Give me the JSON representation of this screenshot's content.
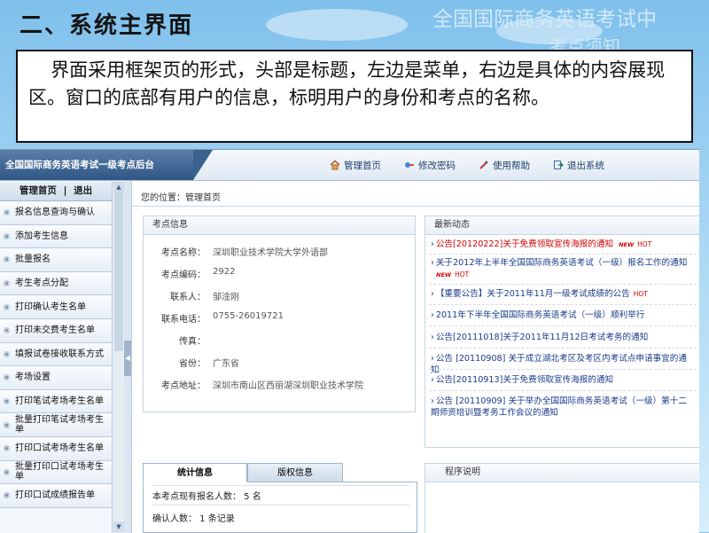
{
  "slide": {
    "title": "二、系统主界面",
    "watermark_line1": "全国国际商务英语考试中",
    "watermark_line2": "考点须知",
    "description": "界面采用框架页的形式，头部是标题，左边是菜单，右边是具体的内容展现区。窗口的底部有用户的信息，标明用户的身份和考点的名称。"
  },
  "app": {
    "brand": "全国国际商务英语考试一级考点后台",
    "nav": [
      {
        "label": "管理首页",
        "icon": "home-icon"
      },
      {
        "label": "修改密码",
        "icon": "key-icon"
      },
      {
        "label": "使用帮助",
        "icon": "help-icon"
      },
      {
        "label": "退出系统",
        "icon": "logout-icon"
      }
    ],
    "sidebar": {
      "home_link": "管理首页",
      "separator": "|",
      "logout_link": "退出",
      "items": [
        "报名信息查询与确认",
        "添加考生信息",
        "批量报名",
        "考生考点分配",
        "打印确认考生名单",
        "打印未交费考生名单",
        "填报试卷接收联系方式",
        "考场设置",
        "打印笔试考场考生名单",
        "批量打印笔试考场考生单",
        "打印口试考场考生名单",
        "批量打印口试考场考生单",
        "打印口试成绩报告单"
      ]
    },
    "breadcrumb": "您的位置：管理首页",
    "site_info": {
      "header": "考点信息",
      "rows": [
        {
          "label": "考点名称：",
          "value": "深圳职业技术学院大学外语部"
        },
        {
          "label": "考点编码：",
          "value": "2922"
        },
        {
          "label": "联系人：",
          "value": "邹淦刚"
        },
        {
          "label": "联系电话：",
          "value": "0755-26019721"
        },
        {
          "label": "传真：",
          "value": ""
        },
        {
          "label": "省份：",
          "value": "广东省"
        },
        {
          "label": "考点地址：",
          "value": "深圳市南山区西丽湖深圳职业技术学院"
        }
      ]
    },
    "news": {
      "header": "最新动态",
      "items": [
        {
          "text": "公告[20120222]关于免费领取宣传海报的通知",
          "new": "NEW",
          "hot": "HOT",
          "red": true
        },
        {
          "text": "关于2012年上半年全国国际商务英语考试（一级）报名工作的通知",
          "new": "NEW",
          "hot": "HOT",
          "red": false
        },
        {
          "text": "【重要公告】关于2011年11月一级考试成绩的公告",
          "new": "",
          "hot": "HOT",
          "red": false
        },
        {
          "text": "2011年下半年全国国际商务英语考试（一级）顺利举行",
          "new": "",
          "hot": "",
          "red": false
        },
        {
          "text": "公告[20111018]关于2011年11月12日考试考务的通知",
          "new": "",
          "hot": "",
          "red": false
        },
        {
          "text": "公告 [20110908] 关于成立湖北考区及考区内考试点申请事宜的通知",
          "new": "",
          "hot": "",
          "red": false
        },
        {
          "text": "公告[20110913]关于免费领取宣传海报的通知",
          "new": "",
          "hot": "",
          "red": false
        },
        {
          "text": "公告 [20110909] 关于举办全国国际商务英语考试（一级）第十二期师资培训暨考务工作会议的通知",
          "new": "",
          "hot": "",
          "red": false
        }
      ]
    },
    "tabs": {
      "active": "统计信息",
      "inactive": "版权信息",
      "stat_registered": "本考点现有报名人数： 5 名",
      "stat_confirmed": "确认人数： 1 条记录"
    },
    "program": {
      "header": "程序说明"
    }
  }
}
